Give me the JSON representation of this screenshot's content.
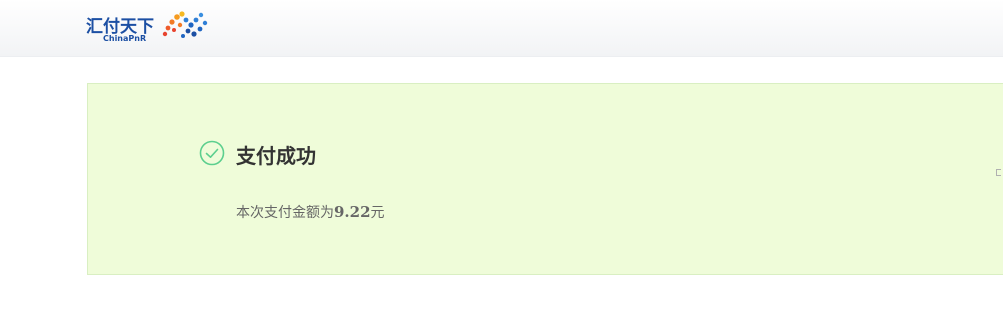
{
  "header": {
    "logo": {
      "name_cn": "汇付天下",
      "name_en": "ChinaPnR",
      "icon": "chinapnr-logo-mark"
    }
  },
  "result": {
    "icon": "check-circle-icon",
    "title": "支付成功",
    "amount_prefix": "本次支付金额为",
    "amount_value": "9.22",
    "amount_unit": "元"
  },
  "colors": {
    "brand_blue": "#1c4fa3",
    "success_green": "#5ccf8e",
    "card_background": "#effcd9",
    "card_border": "#d9efc2"
  }
}
